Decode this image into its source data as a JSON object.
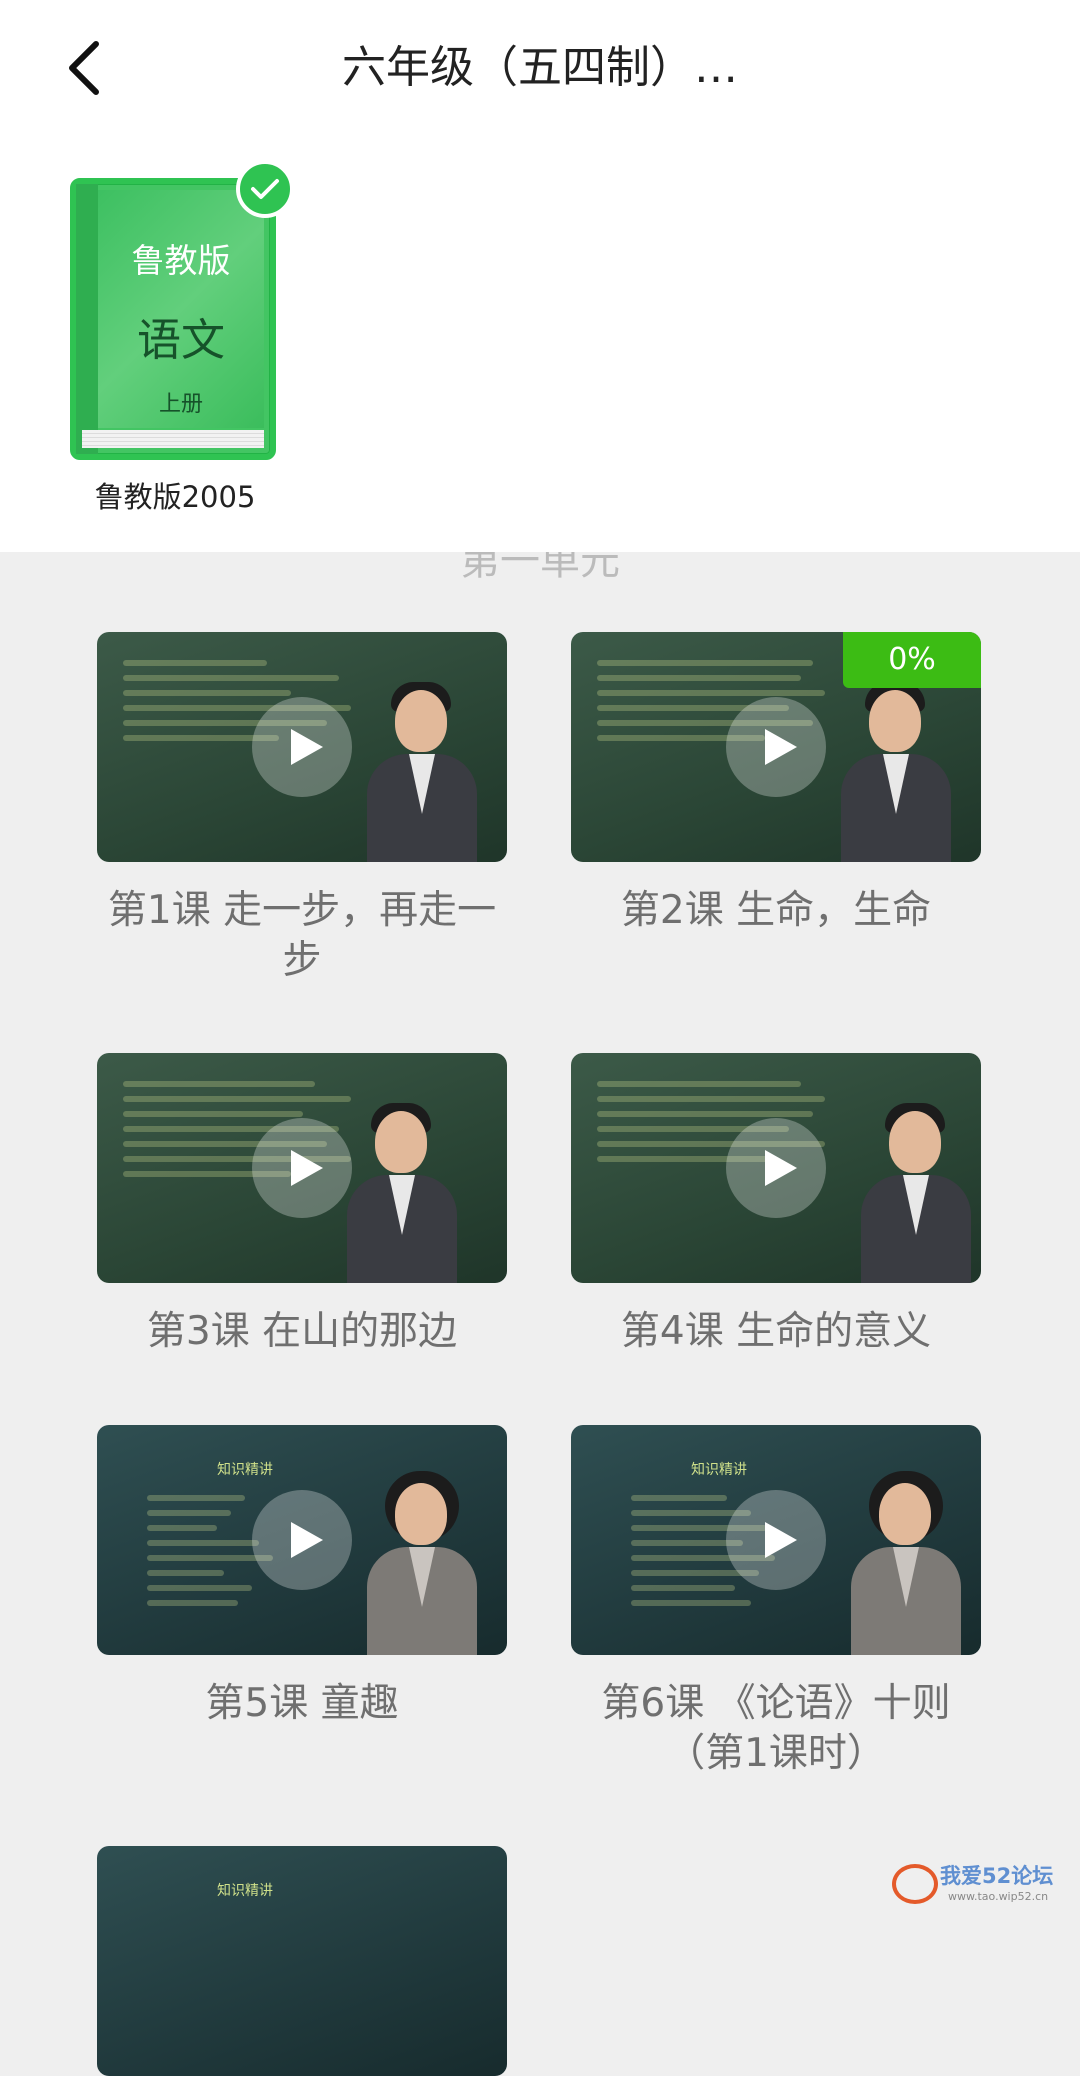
{
  "header": {
    "title": "六年级（五四制）…",
    "back_label": "back"
  },
  "book": {
    "publisher": "鲁教版",
    "subject": "语文",
    "volume": "上册",
    "caption": "鲁教版2005",
    "selected": true
  },
  "section_peek": "第一单元",
  "lessons": [
    {
      "title": "第1课 走一步，再走一步",
      "progress": null,
      "theme": "green"
    },
    {
      "title": "第2课 生命，生命",
      "progress": "0%",
      "theme": "green"
    },
    {
      "title": "第3课 在山的那边",
      "progress": null,
      "theme": "green"
    },
    {
      "title": "第4课 生命的意义",
      "progress": null,
      "theme": "green"
    },
    {
      "title": "第5课 童趣",
      "progress": null,
      "theme": "teal",
      "board_title": "知识精讲"
    },
    {
      "title": "第6课 《论语》十则（第1课时）",
      "progress": null,
      "theme": "teal",
      "board_title": "知识精讲"
    },
    {
      "title": "",
      "progress": null,
      "theme": "teal",
      "board_title": "知识精讲"
    }
  ],
  "watermark": {
    "text": "我爱52论坛",
    "url": "www.tao.wip52.cn"
  },
  "colors": {
    "accent_green": "#2fc352",
    "badge_green": "#3cbc14",
    "background": "#efefef"
  }
}
